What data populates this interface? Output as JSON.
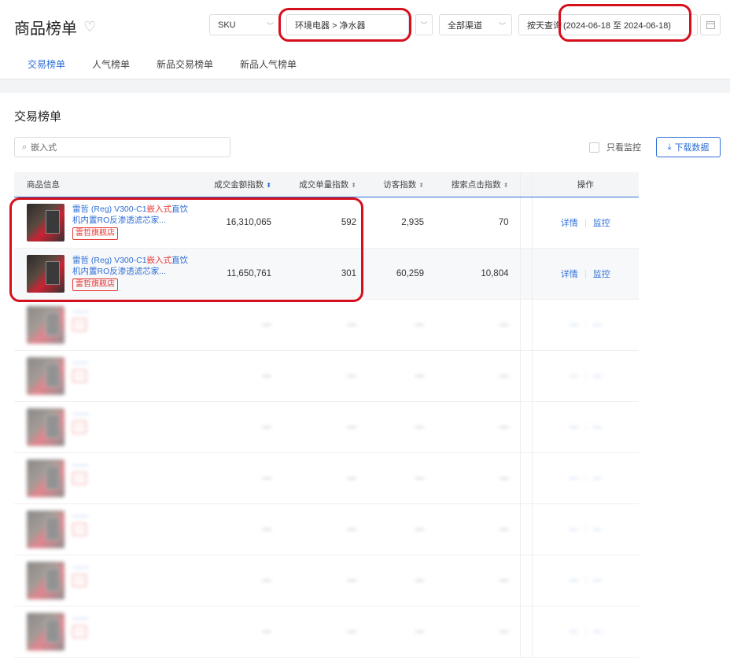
{
  "header": {
    "title": "商品榜单",
    "filters": {
      "sku": "SKU",
      "category": "环境电器 > 净水器",
      "channel": "全部渠道",
      "date_mode": "按天查询",
      "date_range": "(2024-06-18 至 2024-06-18)"
    },
    "tabs": [
      "交易榜单",
      "人气榜单",
      "新品交易榜单",
      "新品人气榜单"
    ]
  },
  "section": {
    "title": "交易榜单",
    "search_placeholder": "嵌入式",
    "only_monitor": "只看监控",
    "download": "下载数据"
  },
  "table": {
    "headers": [
      "商品信息",
      "成交金额指数",
      "成交单量指数",
      "访客指数",
      "搜索点击指数",
      "操作"
    ],
    "rows": [
      {
        "name_a": "雷哲 (Reg) V300-C1",
        "name_red": "嵌入式",
        "name_b": "直饮机内置RO反渗透滤芯家...",
        "shop": "雷哲旗舰店",
        "amount": "16,310,065",
        "orders": "592",
        "visitors": "2,935",
        "search": "70",
        "op1": "详情",
        "op2": "监控"
      },
      {
        "name_a": "雷哲 (Reg) V300-C1",
        "name_red": "嵌入式",
        "name_b": "直饮机内置RO反渗透滤芯家...",
        "shop": "雷哲旗舰店",
        "amount": "11,650,761",
        "orders": "301",
        "visitors": "60,259",
        "search": "10,804",
        "op1": "详情",
        "op2": "监控"
      },
      {
        "name_a": "—",
        "name_red": "",
        "name_b": "—",
        "shop": "—",
        "amount": "—",
        "orders": "—",
        "visitors": "—",
        "search": "—",
        "op1": "—",
        "op2": "—"
      },
      {
        "name_a": "—",
        "name_red": "",
        "name_b": "—",
        "shop": "—",
        "amount": "—",
        "orders": "—",
        "visitors": "—",
        "search": "—",
        "op1": "—",
        "op2": "—"
      },
      {
        "name_a": "—",
        "name_red": "",
        "name_b": "—",
        "shop": "—",
        "amount": "—",
        "orders": "—",
        "visitors": "—",
        "search": "—",
        "op1": "—",
        "op2": "—"
      },
      {
        "name_a": "—",
        "name_red": "",
        "name_b": "—",
        "shop": "—",
        "amount": "—",
        "orders": "—",
        "visitors": "—",
        "search": "—",
        "op1": "—",
        "op2": "—"
      },
      {
        "name_a": "—",
        "name_red": "",
        "name_b": "—",
        "shop": "—",
        "amount": "—",
        "orders": "—",
        "visitors": "—",
        "search": "—",
        "op1": "—",
        "op2": "—"
      },
      {
        "name_a": "—",
        "name_red": "",
        "name_b": "—",
        "shop": "—",
        "amount": "—",
        "orders": "—",
        "visitors": "—",
        "search": "—",
        "op1": "—",
        "op2": "—"
      },
      {
        "name_a": "—",
        "name_red": "",
        "name_b": "—",
        "shop": "—",
        "amount": "—",
        "orders": "—",
        "visitors": "—",
        "search": "—",
        "op1": "—",
        "op2": "—"
      }
    ]
  },
  "colors": {
    "accent": "#2f6fd6",
    "highlight": "#d60f1c",
    "tag_red": "#e53935"
  }
}
